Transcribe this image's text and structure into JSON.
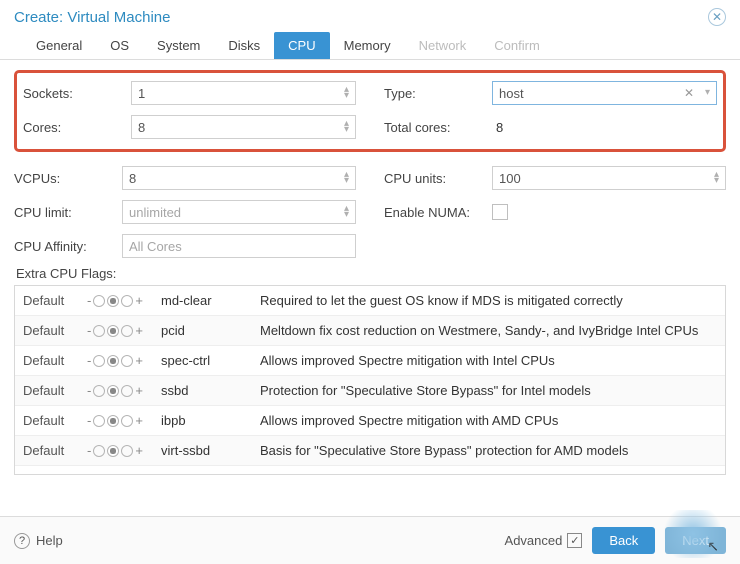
{
  "window": {
    "title": "Create: Virtual Machine"
  },
  "tabs": {
    "items": [
      {
        "label": "General",
        "state": "normal"
      },
      {
        "label": "OS",
        "state": "normal"
      },
      {
        "label": "System",
        "state": "normal"
      },
      {
        "label": "Disks",
        "state": "normal"
      },
      {
        "label": "CPU",
        "state": "active"
      },
      {
        "label": "Memory",
        "state": "normal"
      },
      {
        "label": "Network",
        "state": "disabled"
      },
      {
        "label": "Confirm",
        "state": "disabled"
      }
    ]
  },
  "highlighted": {
    "sockets": {
      "label": "Sockets:",
      "value": "1"
    },
    "cores": {
      "label": "Cores:",
      "value": "8"
    },
    "type": {
      "label": "Type:",
      "value": "host"
    },
    "total": {
      "label": "Total cores:",
      "value": "8"
    }
  },
  "fields": {
    "vcpus": {
      "label": "VCPUs:",
      "value": "8"
    },
    "cpuunits": {
      "label": "CPU units:",
      "value": "100"
    },
    "cpulimit": {
      "label": "CPU limit:",
      "value": "unlimited"
    },
    "numa": {
      "label": "Enable NUMA:"
    },
    "affinity": {
      "label": "CPU Affinity:",
      "value": "All Cores"
    }
  },
  "flags": {
    "heading": "Extra CPU Flags:",
    "default_label": "Default",
    "rows": [
      {
        "name": "md-clear",
        "desc": "Required to let the guest OS know if MDS is mitigated correctly"
      },
      {
        "name": "pcid",
        "desc": "Meltdown fix cost reduction on Westmere, Sandy-, and IvyBridge Intel CPUs"
      },
      {
        "name": "spec-ctrl",
        "desc": "Allows improved Spectre mitigation with Intel CPUs"
      },
      {
        "name": "ssbd",
        "desc": "Protection for \"Speculative Store Bypass\" for Intel models"
      },
      {
        "name": "ibpb",
        "desc": "Allows improved Spectre mitigation with AMD CPUs"
      },
      {
        "name": "virt-ssbd",
        "desc": "Basis for \"Speculative Store Bypass\" protection for AMD models"
      }
    ]
  },
  "footer": {
    "help": "Help",
    "advanced": "Advanced",
    "back": "Back",
    "next": "Next"
  }
}
